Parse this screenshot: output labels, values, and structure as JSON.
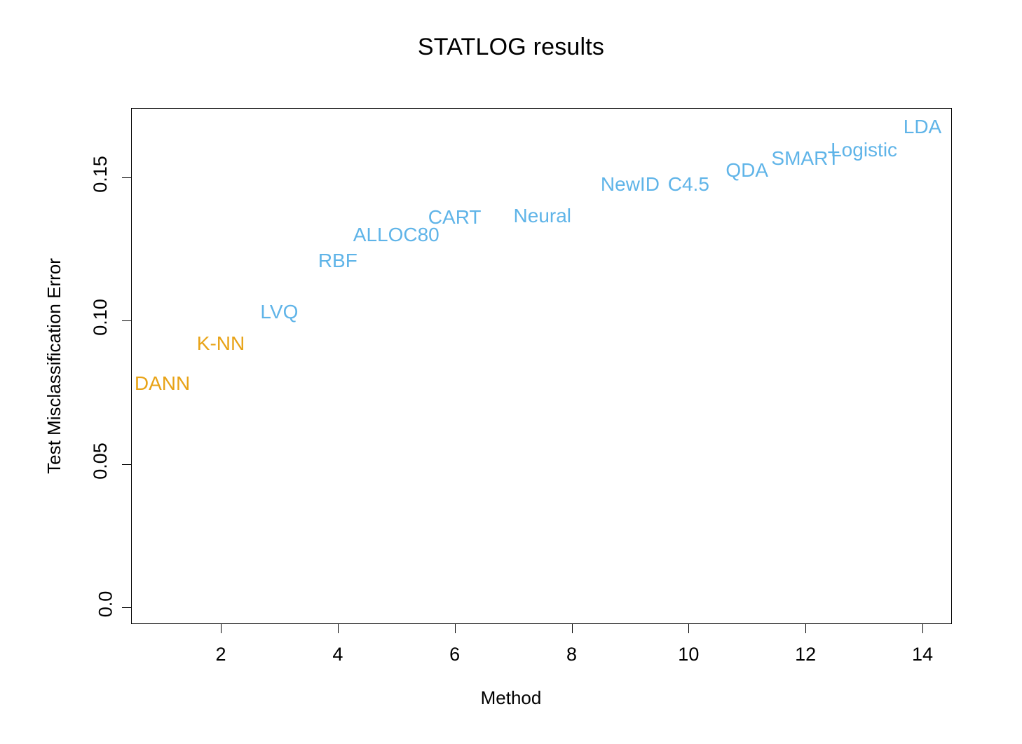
{
  "chart_data": {
    "type": "scatter",
    "title": "STATLOG results",
    "xlabel": "Method",
    "ylabel": "Test Misclassification Error",
    "xlim": [
      0.45,
      14.6
    ],
    "ylim": [
      0.0,
      0.175
    ],
    "grid": false,
    "legend": "none",
    "xticks": [
      2,
      4,
      6,
      8,
      10,
      12,
      14
    ],
    "xtick_labels": [
      "2",
      "4",
      "6",
      "8",
      "10",
      "12",
      "14"
    ],
    "yticks": [
      0.0,
      0.05,
      0.1,
      0.15
    ],
    "ytick_labels": [
      "0.0",
      "0.05",
      "0.10",
      "0.15"
    ],
    "marker_style": "text-label",
    "colors": {
      "highlight": "#E8A317",
      "standard": "#5FB4E8",
      "axis": "#000000",
      "background": "#FFFFFF"
    },
    "points": [
      {
        "label": "DANN",
        "x": 1,
        "y": 0.078,
        "color": "#E8A317",
        "group": "highlight"
      },
      {
        "label": "K-NN",
        "x": 2,
        "y": 0.092,
        "color": "#E8A317",
        "group": "highlight"
      },
      {
        "label": "LVQ",
        "x": 3,
        "y": 0.103,
        "color": "#5FB4E8",
        "group": "standard"
      },
      {
        "label": "RBF",
        "x": 4,
        "y": 0.121,
        "color": "#5FB4E8",
        "group": "standard"
      },
      {
        "label": "ALLOC80",
        "x": 5,
        "y": 0.13,
        "color": "#5FB4E8",
        "group": "standard"
      },
      {
        "label": "CART",
        "x": 6,
        "y": 0.136,
        "color": "#5FB4E8",
        "group": "standard"
      },
      {
        "label": "Neural",
        "x": 7.5,
        "y": 0.1365,
        "color": "#5FB4E8",
        "group": "standard"
      },
      {
        "label": "NewID",
        "x": 9,
        "y": 0.1475,
        "color": "#5FB4E8",
        "group": "standard"
      },
      {
        "label": "C4.5",
        "x": 10,
        "y": 0.1475,
        "color": "#5FB4E8",
        "group": "standard"
      },
      {
        "label": "QDA",
        "x": 11,
        "y": 0.1525,
        "color": "#5FB4E8",
        "group": "standard"
      },
      {
        "label": "SMART",
        "x": 12,
        "y": 0.1565,
        "color": "#5FB4E8",
        "group": "standard"
      },
      {
        "label": "Logistic",
        "x": 13,
        "y": 0.1595,
        "color": "#5FB4E8",
        "group": "standard"
      },
      {
        "label": "LDA",
        "x": 14,
        "y": 0.1675,
        "color": "#5FB4E8",
        "group": "standard"
      }
    ]
  }
}
